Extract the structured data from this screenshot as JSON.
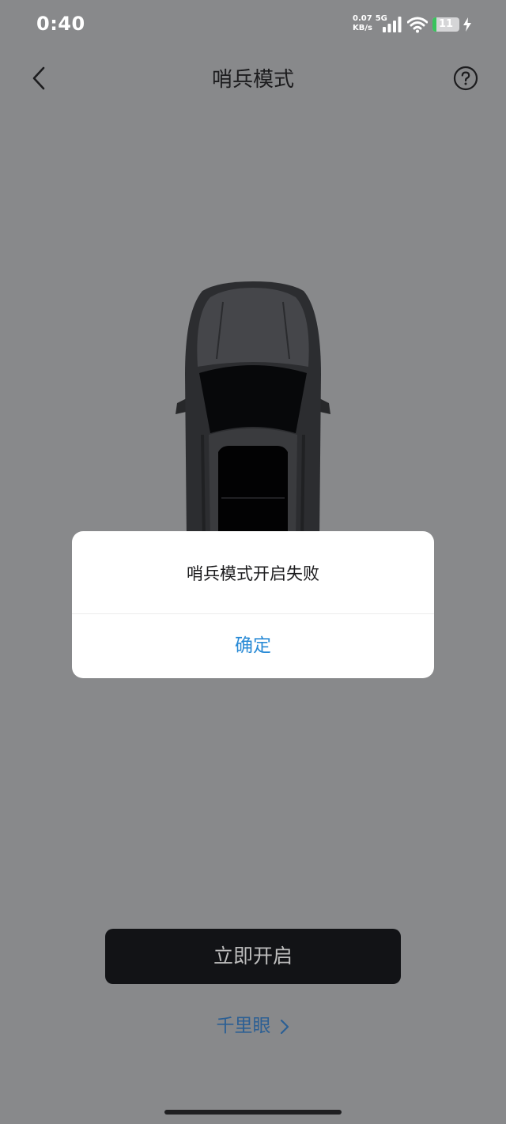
{
  "status_bar": {
    "time": "0:40",
    "net_speed_value": "0.07",
    "net_type": "5G",
    "net_speed_unit": "KB/s",
    "battery_level": "11",
    "icons": [
      "signal-icon",
      "wifi-icon",
      "battery-icon",
      "charging-bolt-icon"
    ]
  },
  "header": {
    "title": "哨兵模式",
    "back_icon": "chevron-left-icon",
    "help_icon": "question-circle-icon"
  },
  "dialog": {
    "message": "哨兵模式开启失败",
    "confirm_label": "确定",
    "confirm_color": "#2a8bd6"
  },
  "main": {
    "start_button_label": "立即开启",
    "eye_link_label": "千里眼",
    "eye_link_icon": "chevron-right-icon"
  },
  "colors": {
    "overlay_background": "#88898b",
    "link_color": "#2b5f94",
    "button_background": "#121316"
  }
}
